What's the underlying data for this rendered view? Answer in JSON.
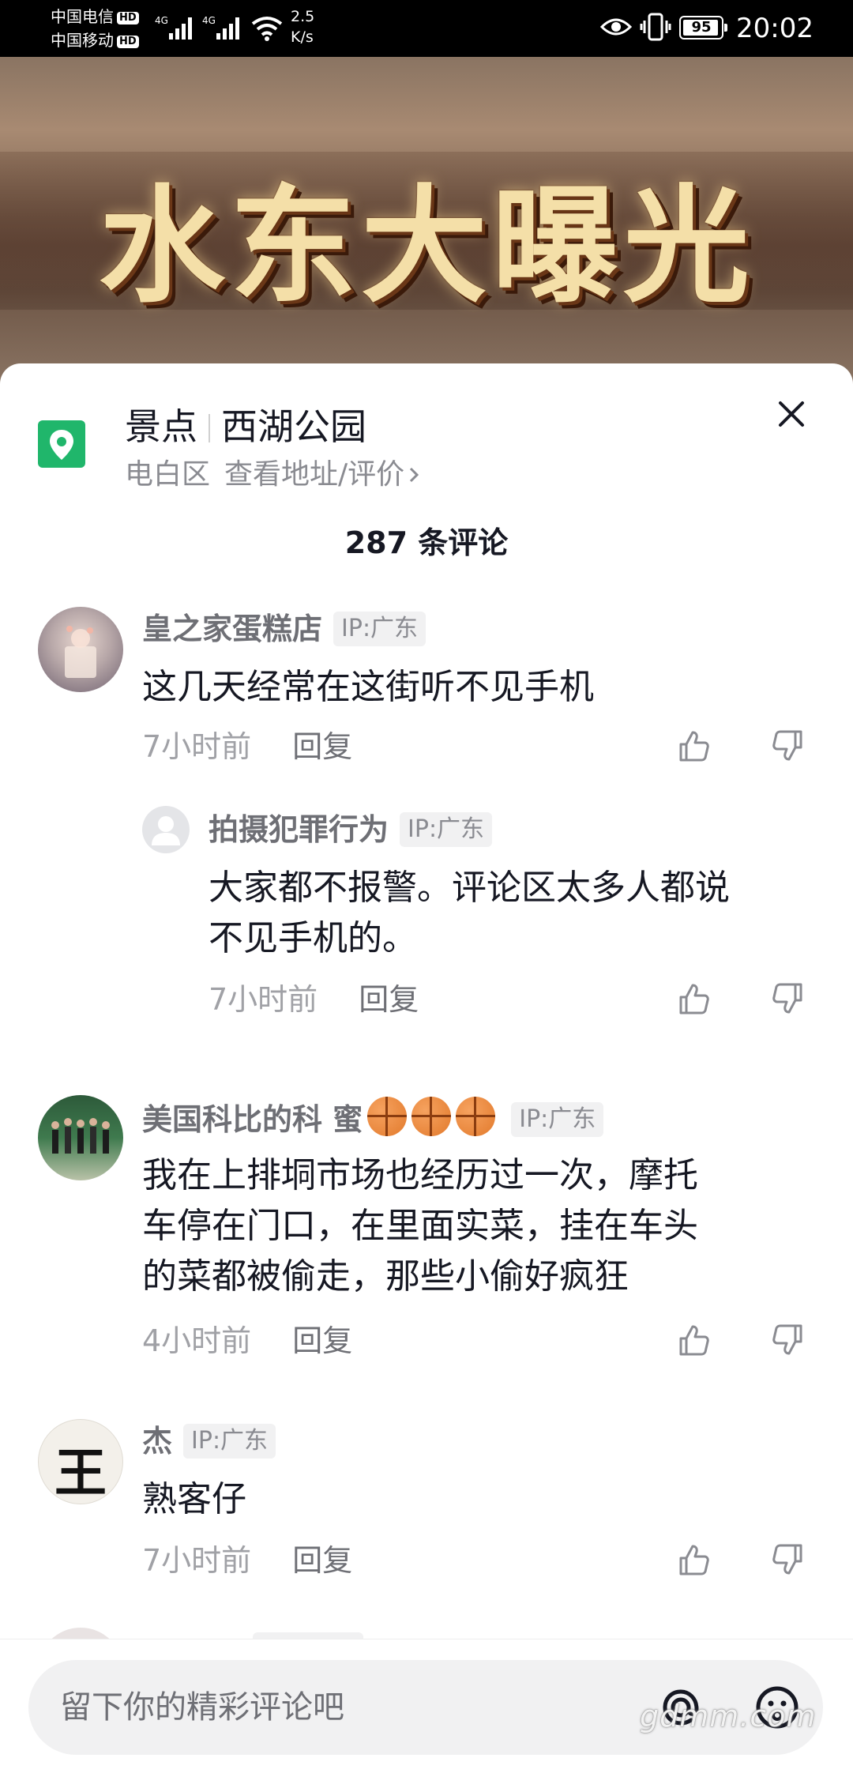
{
  "status_bar": {
    "carrier1": "中国电信",
    "carrier2": "中国移动",
    "hd": "HD",
    "net": "4G",
    "speed_value": "2.5",
    "speed_unit": "K/s",
    "battery": "95",
    "battery_level": 0.95,
    "time": "20:02"
  },
  "video": {
    "title": "水东大曝光"
  },
  "location": {
    "category": "景点",
    "name": "西湖公园",
    "district": "电白区",
    "link": "查看地址/评价",
    "icon": "location-pin-icon",
    "color": "#20b66b"
  },
  "comments_count": "287 条评论",
  "comments": [
    {
      "user": "皇之家蛋糕店",
      "ip": "IP:广东",
      "text": "这几天经常在这街听不见手机",
      "time": "7小时前",
      "reply": "回复"
    },
    {
      "user": "拍摄犯罪行为",
      "ip": "IP:广东",
      "text_line1": "大家都不报警。评论区太多人都说",
      "text_line2": "不见手机的。",
      "time": "7小时前",
      "reply": "回复"
    },
    {
      "user": "美国科比的科 蜜",
      "ip": "IP:广东",
      "text_line1": "我在上排垌市场也经历过一次，摩托",
      "text_line2": "车停在门口，在里面实菜，挂在车头",
      "text_line3": "的菜都被偷走，那些小偷好疯狂",
      "time": "4小时前",
      "reply": "回复"
    },
    {
      "user": "杰",
      "ip": "IP:广东",
      "avatar_char": "王",
      "text": "熟客仔",
      "time": "7小时前",
      "reply": "回复"
    }
  ],
  "input": {
    "placeholder": "留下你的精彩评论吧"
  },
  "watermark": "gdmm.com"
}
